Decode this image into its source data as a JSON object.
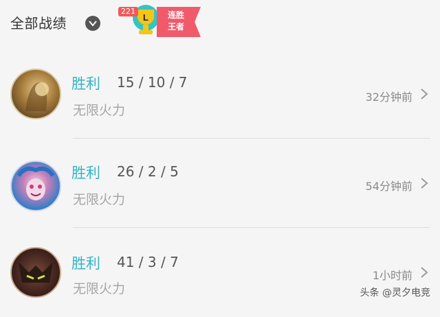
{
  "header": {
    "title": "全部战绩",
    "trophy_count": "221",
    "trophy_letter": "L",
    "ribbon_line1": "连胜",
    "ribbon_line2": "王者"
  },
  "records": [
    {
      "result": "胜利",
      "kda": "15 / 10 / 7",
      "mode": "无限火力",
      "time": "32分钟前",
      "avatar_icon": "champion-avatar-golden"
    },
    {
      "result": "胜利",
      "kda": "26 / 2 / 5",
      "mode": "无限火力",
      "time": "54分钟前",
      "avatar_icon": "champion-avatar-jinx"
    },
    {
      "result": "胜利",
      "kda": "41 / 3 / 7",
      "mode": "无限火力",
      "time": "1小时前",
      "avatar_icon": "champion-avatar-dark"
    }
  ],
  "watermark": "头条 @灵夕电竞",
  "colors": {
    "result": "#33b3c6",
    "ribbon": "#f05a6a",
    "trophy": "#f5c518"
  }
}
